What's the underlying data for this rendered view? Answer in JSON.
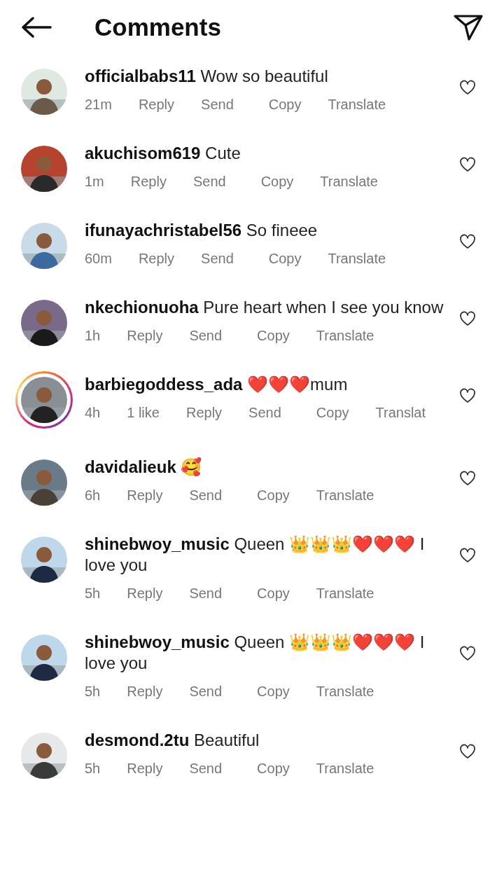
{
  "header": {
    "title": "Comments"
  },
  "comments": [
    {
      "username": "officialbabs11",
      "text": "Wow so beautiful",
      "time": "21m",
      "actions": [
        "Reply",
        "Send",
        "Copy",
        "Translate"
      ],
      "story": false,
      "liked": false
    },
    {
      "username": "akuchisom619",
      "text": "Cute",
      "time": "1m",
      "actions": [
        "Reply",
        "Send",
        "Copy",
        "Translate"
      ],
      "story": false,
      "liked": false
    },
    {
      "username": "ifunayachristabel56",
      "text": "So fineee",
      "time": "60m",
      "actions": [
        "Reply",
        "Send",
        "Copy",
        "Translate"
      ],
      "story": false,
      "liked": false
    },
    {
      "username": "nkechionuoha",
      "text": "Pure heart when  I see you know",
      "time": "1h",
      "actions": [
        "Reply",
        "Send",
        "Copy",
        "Translate"
      ],
      "story": false,
      "liked": false
    },
    {
      "username": "barbiegoddess_ada",
      "text": "❤️❤️❤️mum",
      "time": "4h",
      "likes": "1 like",
      "actions": [
        "Reply",
        "Send",
        "Copy",
        "Translat"
      ],
      "story": true,
      "liked": false
    },
    {
      "username": "davidalieuk",
      "text": "🥰",
      "time": "6h",
      "actions": [
        "Reply",
        "Send",
        "Copy",
        "Translate"
      ],
      "story": false,
      "liked": false
    },
    {
      "username": "shinebwoy_music",
      "text": "Queen 👑👑👑❤️❤️❤️ I love you",
      "time": "5h",
      "actions": [
        "Reply",
        "Send",
        "Copy",
        "Translate"
      ],
      "story": false,
      "liked": false
    },
    {
      "username": "shinebwoy_music",
      "text": "Queen 👑👑👑❤️❤️❤️ I love you",
      "time": "5h",
      "actions": [
        "Reply",
        "Send",
        "Copy",
        "Translate"
      ],
      "story": false,
      "liked": false
    },
    {
      "username": "desmond.2tu",
      "text": "Beautiful",
      "time": "5h",
      "actions": [
        "Reply",
        "Send",
        "Copy",
        "Translate"
      ],
      "story": false,
      "liked": false
    }
  ]
}
